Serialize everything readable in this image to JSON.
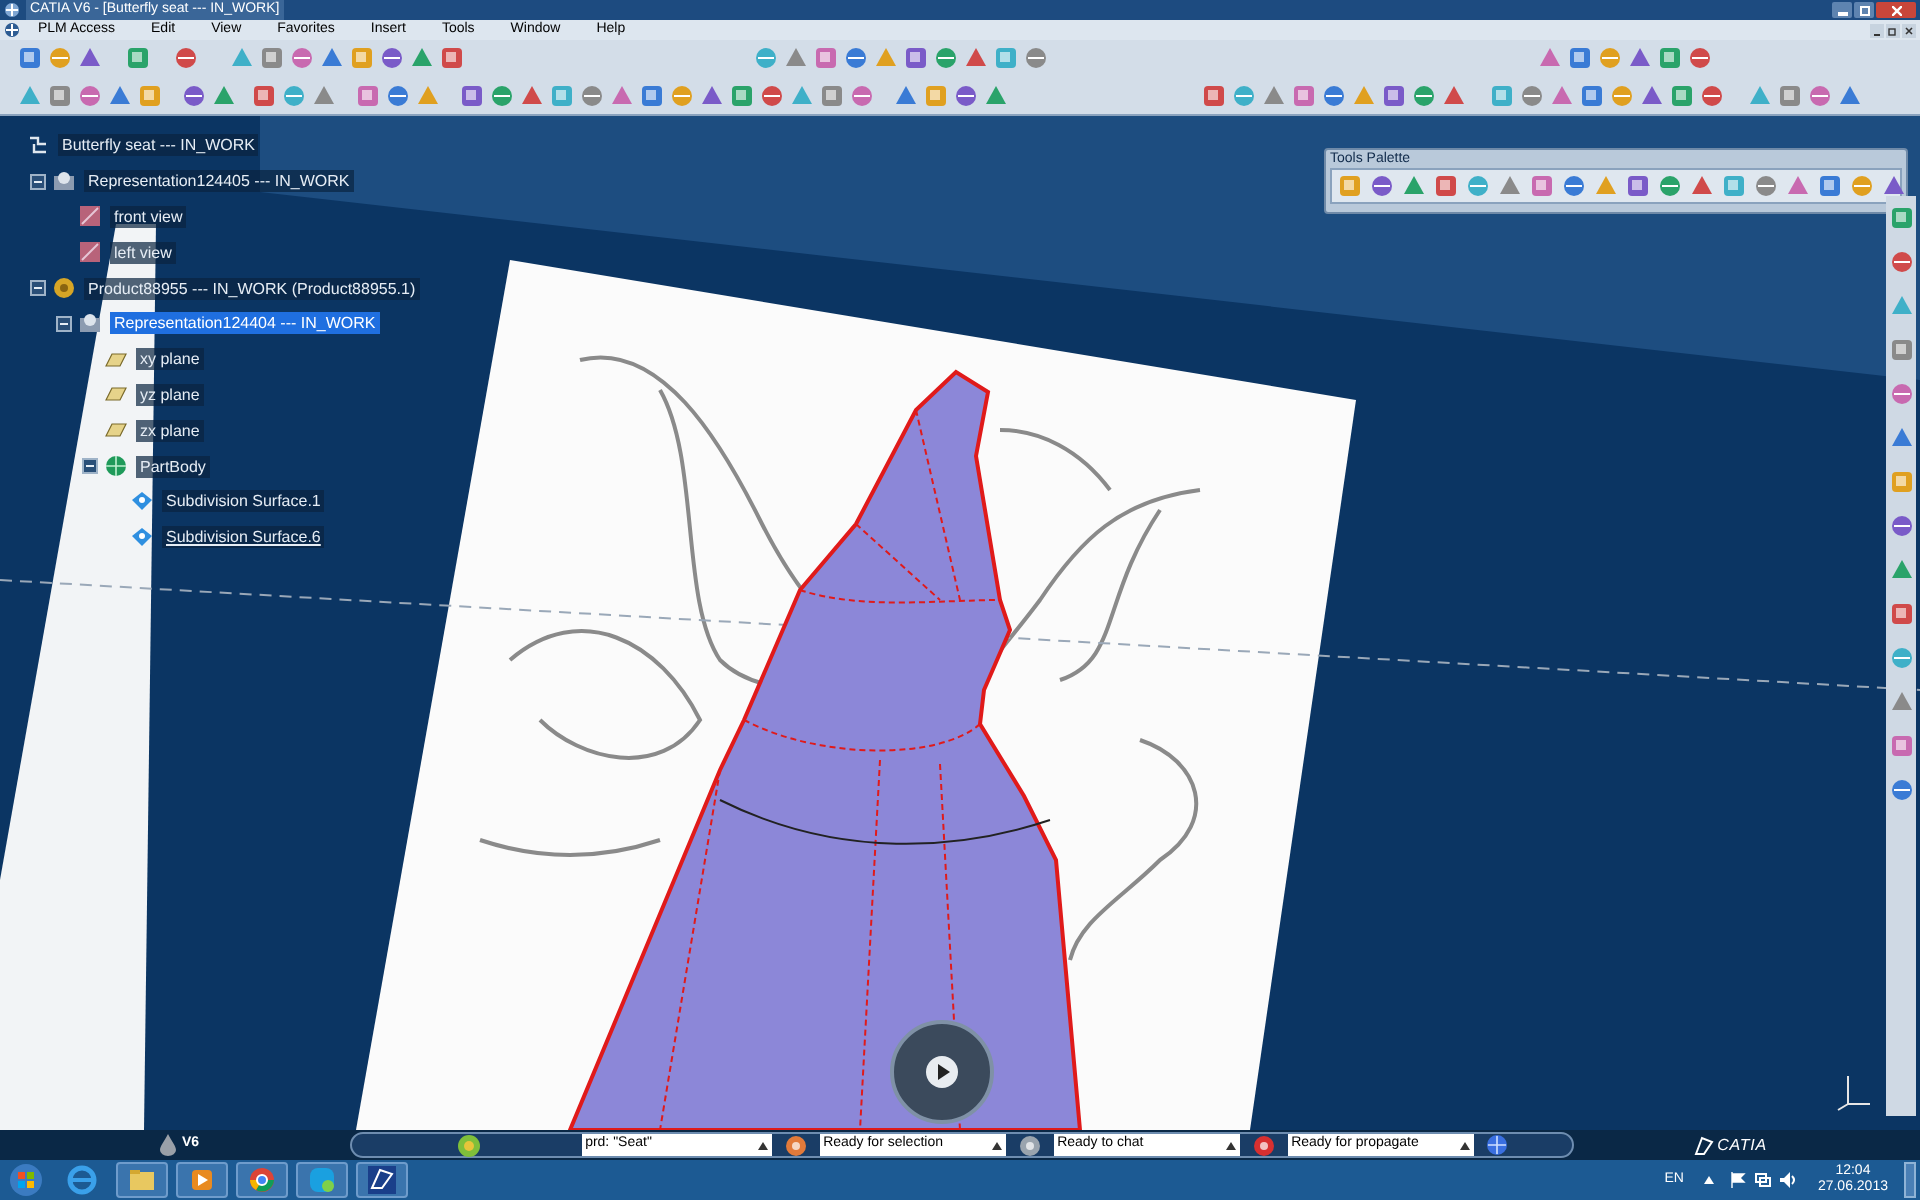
{
  "window": {
    "title": "CATIA V6 - [Butterfly seat --- IN_WORK]"
  },
  "menu": [
    "PLM Access",
    "Edit",
    "View",
    "Favorites",
    "Insert",
    "Tools",
    "Window",
    "Help"
  ],
  "tree": [
    {
      "label": "Butterfly seat --- IN_WORK",
      "kind": "root",
      "selected": false,
      "underlined": false,
      "children": [
        {
          "label": "Representation124405 --- IN_WORK",
          "kind": "representation",
          "selected": false,
          "underlined": false,
          "expanded": true,
          "children": [
            {
              "label": "front view",
              "kind": "view",
              "selected": false,
              "underlined": false
            },
            {
              "label": "left view",
              "kind": "view",
              "selected": false,
              "underlined": false
            }
          ]
        },
        {
          "label": "Product88955 --- IN_WORK (Product88955.1)",
          "kind": "product",
          "selected": false,
          "underlined": false,
          "expanded": true,
          "children": [
            {
              "label": "Representation124404 --- IN_WORK",
              "kind": "representation",
              "selected": true,
              "underlined": false,
              "expanded": true,
              "children": [
                {
                  "label": "xy plane",
                  "kind": "plane",
                  "selected": false,
                  "underlined": false
                },
                {
                  "label": "yz plane",
                  "kind": "plane",
                  "selected": false,
                  "underlined": false
                },
                {
                  "label": "zx plane",
                  "kind": "plane",
                  "selected": false,
                  "underlined": false
                },
                {
                  "label": "PartBody",
                  "kind": "body",
                  "selected": false,
                  "underlined": false,
                  "expanded": true,
                  "children": [
                    {
                      "label": "Subdivision Surface.1",
                      "kind": "surface",
                      "selected": false,
                      "underlined": false
                    },
                    {
                      "label": "Subdivision Surface.6",
                      "kind": "surface",
                      "selected": false,
                      "underlined": true
                    }
                  ]
                }
              ]
            }
          ]
        }
      ]
    }
  ],
  "tools_palette": {
    "title": "Tools Palette"
  },
  "status_bar": {
    "app_label": "V6",
    "command_field": {
      "value": "prd: \"Seat\""
    },
    "fields": [
      "Ready for selection",
      "Ready to chat",
      "Ready for propagate"
    ],
    "brand": "CATIA"
  },
  "taskbar": {
    "language": "EN",
    "time": "12:04",
    "date": "27.06.2013"
  }
}
